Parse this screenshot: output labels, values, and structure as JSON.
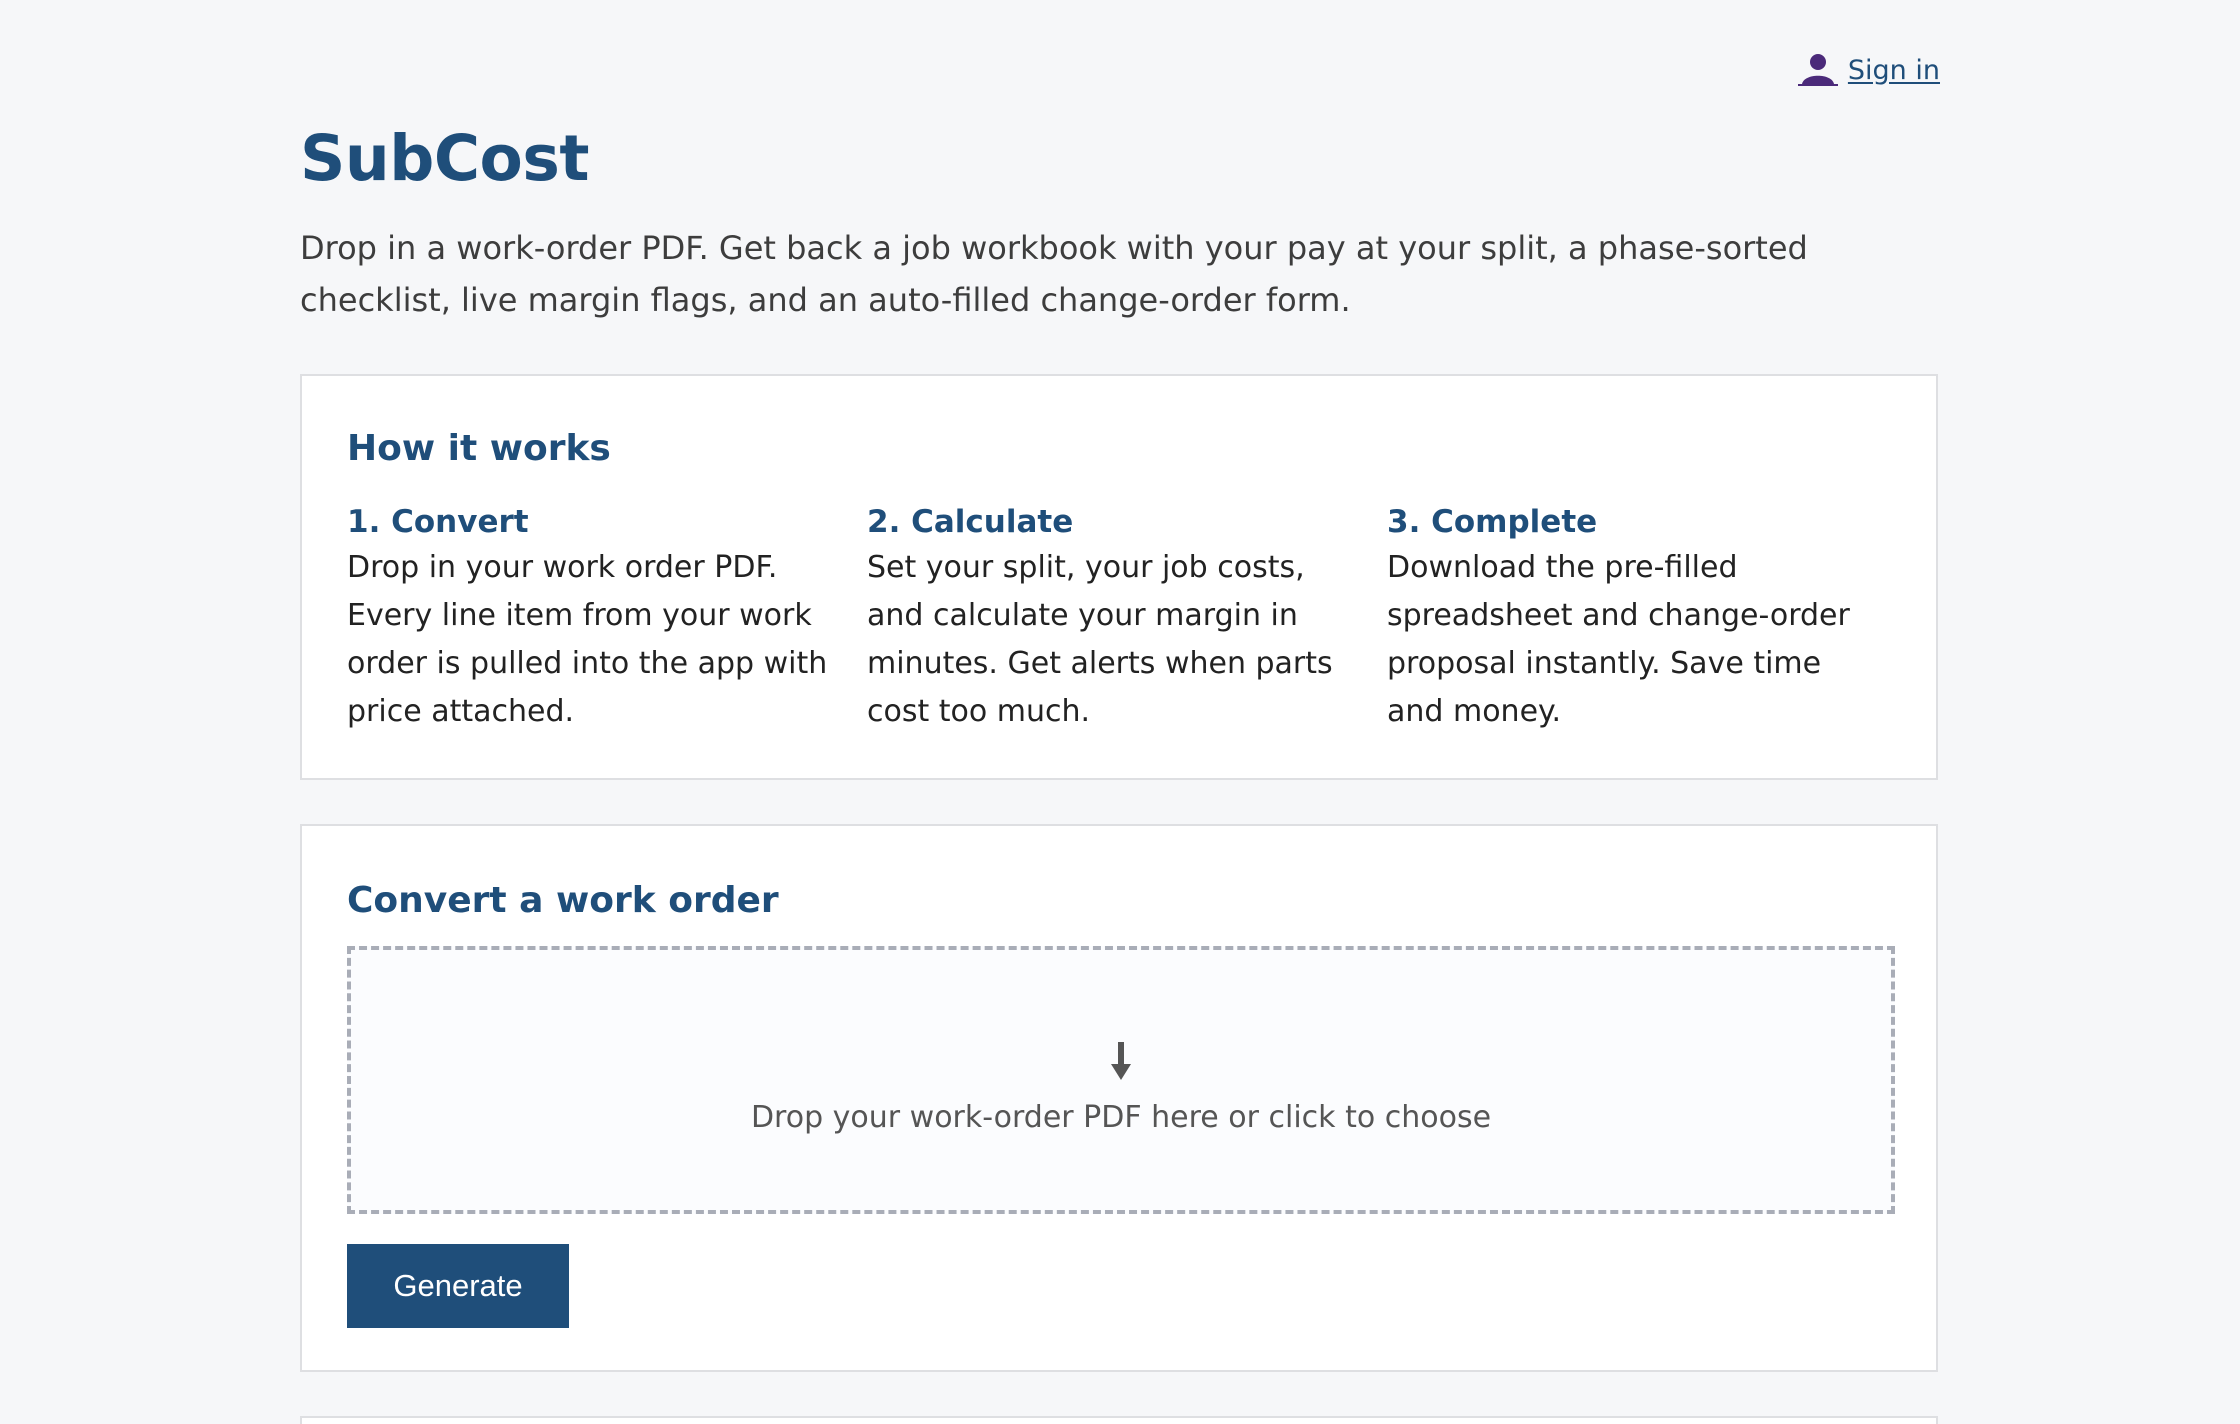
{
  "header": {
    "signin_label": "Sign in",
    "signin_icon": "user-icon"
  },
  "app": {
    "title": "SubCost",
    "tagline": "Drop in a work-order PDF. Get back a job workbook with your pay at your split, a phase-sorted checklist, live margin flags, and an auto-filled change-order form."
  },
  "how_it_works": {
    "heading": "How it works",
    "steps": [
      {
        "title": "1. Convert",
        "text": "Drop in your work order PDF. Every line item from your work order is pulled into the app with price attached."
      },
      {
        "title": "2. Calculate",
        "text": "Set your split, your job costs, and calculate your margin in minutes. Get alerts when parts cost too much."
      },
      {
        "title": "3. Complete",
        "text": "Download the pre-filled spreadsheet and change-order proposal instantly. Save time and money."
      }
    ]
  },
  "convert": {
    "heading": "Convert a work order",
    "dropzone_text": "Drop your work-order PDF here or click to choose",
    "dropzone_icon": "download-arrow-icon",
    "generate_label": "Generate"
  },
  "colors": {
    "brand": "#1f4e7a",
    "background": "#f6f7f9",
    "card": "#ffffff",
    "signin_icon": "#4b2a7a"
  }
}
